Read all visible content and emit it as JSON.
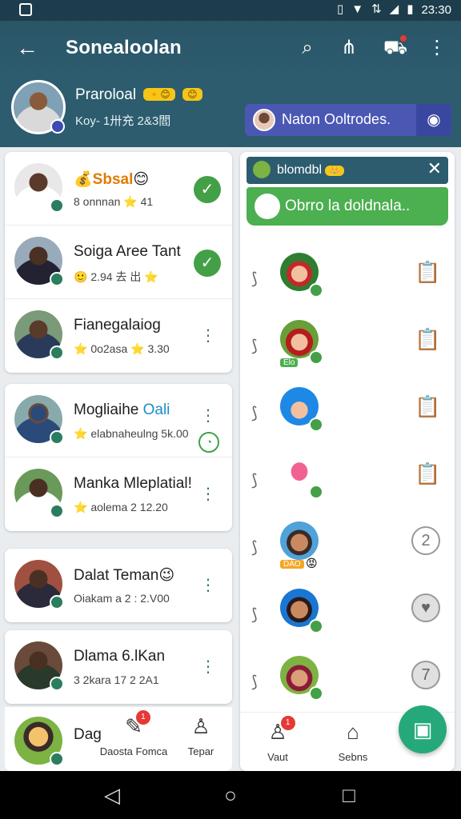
{
  "status_bar": {
    "time": "23:30",
    "icons": [
      "app-icon",
      "vibrate-icon",
      "wifi-icon",
      "data-icon",
      "signal-icon",
      "battery-icon"
    ]
  },
  "app_bar": {
    "title": "Sonealoolan",
    "actions": [
      "search-icon",
      "share-icon",
      "cart-icon",
      "more-icon"
    ]
  },
  "profile": {
    "name": "Praroloal",
    "badges": [
      "🔸😊",
      "😊"
    ],
    "sub": "Koy- 1卅充 2&3閻",
    "chip_label": "Naton Ooltrodes."
  },
  "contacts": [
    {
      "name": "Sbsal",
      "name_prefix": "💰",
      "name_suffix": "😊",
      "sub": "8 onnnan ⭐ 41",
      "status": "check"
    },
    {
      "name": "Soiga Aree Tant",
      "sub": "🙂 2.94 去 出 ⭐",
      "status": "check"
    },
    {
      "name": "Fianegalaiog",
      "sub": "⭐ 0o2asa ⭐ 3.30",
      "status": "more"
    },
    {
      "name": "Mogliaihe",
      "name_accent": "Oali",
      "sub": "⭐ elabnaheulng 5k.00",
      "status": "more_timer"
    },
    {
      "name": "Manka Mleplatial!",
      "sub": "⭐ aolema 2 12.20",
      "status": "more"
    },
    {
      "name": "Dalat Teman😉",
      "sub": "Oiakam a 2 : 2.V00",
      "status": "more"
    },
    {
      "name": "Dlama 6.lKan",
      "sub": "3 2kara 17 2 2A1",
      "status": "more"
    },
    {
      "name": "Dag",
      "sub": "",
      "status": "none"
    }
  ],
  "left_nav": [
    {
      "label": "Daosta Fomca",
      "icon": "chat-icon",
      "badge": "1"
    },
    {
      "label": "Tepar",
      "icon": "person-icon",
      "badge": ""
    }
  ],
  "right_panel": {
    "header_title": "blomdbl",
    "header_badge": "👑",
    "green_banner": "Obrro la doldnala..",
    "members": [
      {
        "tag": "",
        "emoji": "",
        "action": "clipboard-icon",
        "action_text": "📋"
      },
      {
        "tag": "Elo",
        "emoji": "",
        "action": "clipboard-icon",
        "action_text": "📋"
      },
      {
        "tag": "",
        "emoji": "",
        "action": "clipboard-icon",
        "action_text": "📋"
      },
      {
        "tag": "",
        "emoji": "",
        "action": "clipboard-icon",
        "action_text": "📋"
      },
      {
        "tag": "DAO",
        "emoji": "😡",
        "action": "number-circle",
        "action_text": "2"
      },
      {
        "tag": "",
        "emoji": "",
        "action": "heart-circle",
        "action_text": "♥"
      },
      {
        "tag": "",
        "emoji": "",
        "action": "seven-circle",
        "action_text": "7"
      }
    ]
  },
  "right_nav": [
    {
      "label": "Vaut",
      "icon": "person-icon",
      "badge": "1"
    },
    {
      "label": "Sebns",
      "icon": "home-icon",
      "badge": ""
    }
  ],
  "fab": {
    "icon": "new-message-icon"
  },
  "colors": {
    "primary": "#2c5c6e",
    "accent_green": "#4caf50",
    "fab": "#26a97a",
    "chip": "#4a58b4"
  }
}
